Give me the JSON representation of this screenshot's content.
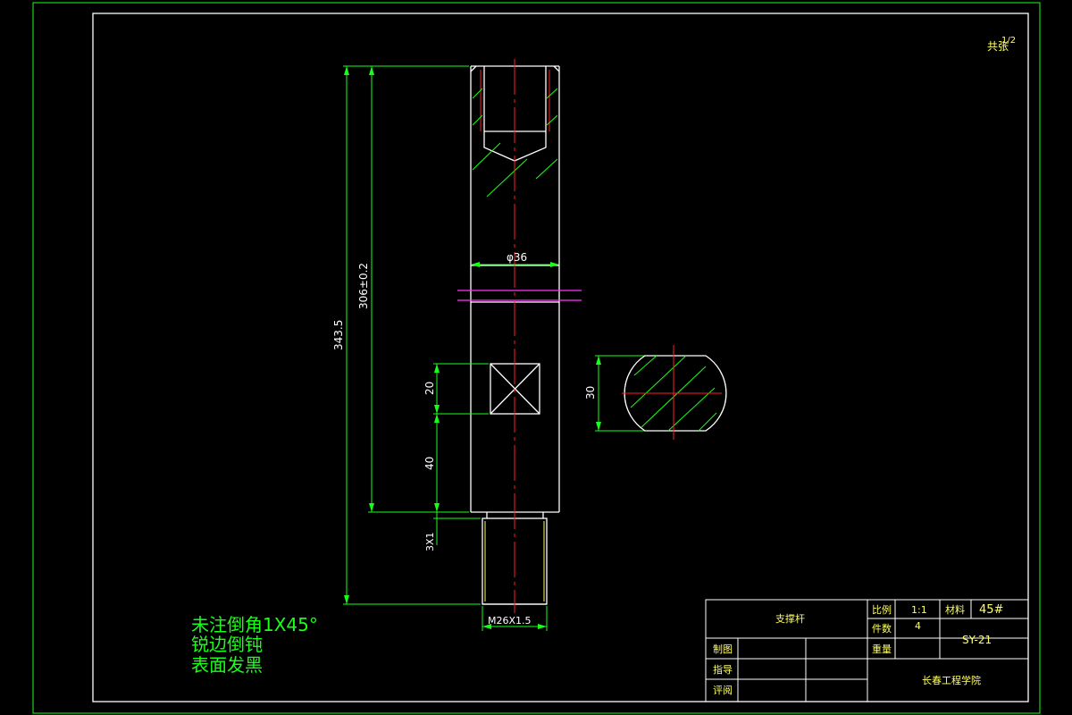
{
  "drawing": {
    "sheet_number": "共张",
    "sheet_fraction": "1/2",
    "dimensions": {
      "overall_length": "343.5",
      "main_length": "306±0.2",
      "diameter": "φ36",
      "square_size": "20",
      "square_offset": "40",
      "undercut": "3X1",
      "thread": "M26X1.5",
      "section_width": "30"
    },
    "notes": [
      "未注倒角1X45°",
      "锐边倒钝",
      "表面发黑"
    ]
  },
  "title_block": {
    "part_name": "支撑杆",
    "scale_label": "比例",
    "scale_value": "1:1",
    "material_label": "材料",
    "material_value": "45#",
    "quantity_label": "件数",
    "quantity_value": "4",
    "drawing_no": "SY-21",
    "weight_label": "重量",
    "drawn_label": "制图",
    "guide_label": "指导",
    "review_label": "评阅",
    "school": "长春工程学院"
  },
  "colors": {
    "outline": "#ffffff",
    "dimension": "#19ff19",
    "centerline": "#ff2020",
    "hidden": "#ff2020",
    "hatch": "#19ff19",
    "magenta": "#ff33ff",
    "text_yellow": "#ffff66"
  }
}
